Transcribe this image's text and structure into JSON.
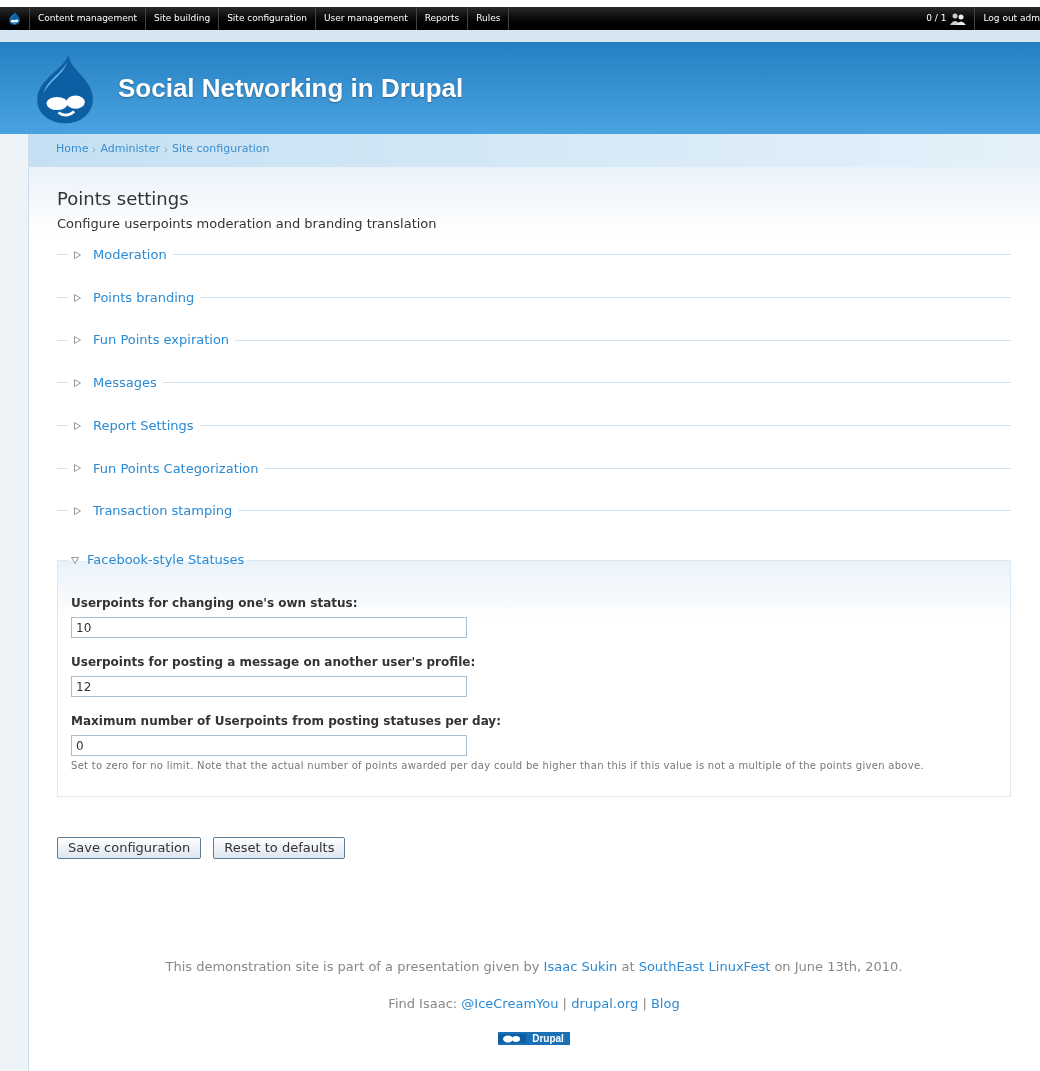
{
  "toolbar": {
    "menu": [
      "Content management",
      "Site building",
      "Site configuration",
      "User management",
      "Reports",
      "Rules"
    ],
    "user_count": "0 / 1",
    "logout": "Log out adm"
  },
  "site_name": "Social Networking in Drupal",
  "breadcrumb": [
    "Home",
    "Administer",
    "Site configuration"
  ],
  "page": {
    "title": "Points settings",
    "description": "Configure userpoints moderation and branding translation"
  },
  "fieldsets": [
    {
      "title": "Moderation",
      "expanded": false
    },
    {
      "title": "Points branding",
      "expanded": false
    },
    {
      "title": "Fun Points expiration",
      "expanded": false
    },
    {
      "title": "Messages",
      "expanded": false
    },
    {
      "title": "Report Settings",
      "expanded": false
    },
    {
      "title": "Fun Points Categorization",
      "expanded": false
    },
    {
      "title": "Transaction stamping",
      "expanded": false
    },
    {
      "title": "Facebook-style Statuses",
      "expanded": true,
      "fields": [
        {
          "label": "Userpoints for changing one's own status:",
          "value": "10"
        },
        {
          "label": "Userpoints for posting a message on another user's profile:",
          "value": "12"
        },
        {
          "label": "Maximum number of Userpoints from posting statuses per day:",
          "value": "0",
          "description": "Set to zero for no limit. Note that the actual number of points awarded per day could be higher than this if this value is not a multiple of the points given above."
        }
      ]
    }
  ],
  "buttons": [
    "Save configuration",
    "Reset to defaults"
  ],
  "footer": {
    "lines": [
      [
        {
          "kind": "text",
          "text": "This demonstration site is part of a presentation given by "
        },
        {
          "kind": "link",
          "text": "Isaac Sukin"
        },
        {
          "kind": "text",
          "text": " at "
        },
        {
          "kind": "link",
          "text": "SouthEast LinuxFest"
        },
        {
          "kind": "text",
          "text": " on June 13th, 2010."
        }
      ],
      [
        {
          "kind": "text",
          "text": "Find Isaac: "
        },
        {
          "kind": "link",
          "text": "@IceCreamYou"
        },
        {
          "kind": "text",
          "text": " | "
        },
        {
          "kind": "link",
          "text": "drupal.org"
        },
        {
          "kind": "text",
          "text": " | "
        },
        {
          "kind": "link",
          "text": "Blog"
        }
      ]
    ],
    "badge": "Drupal"
  }
}
